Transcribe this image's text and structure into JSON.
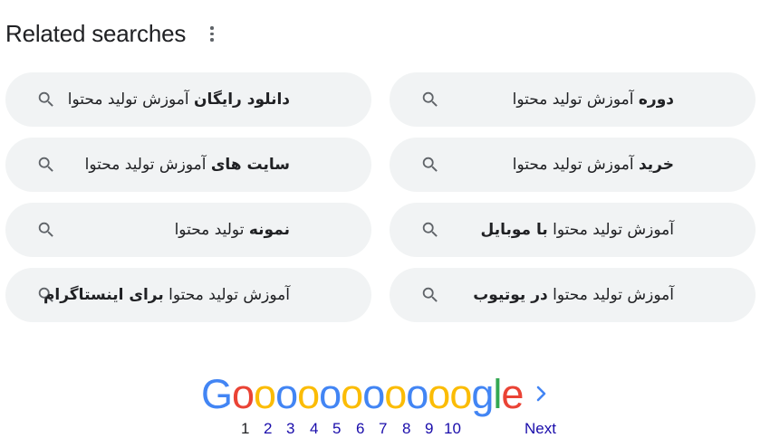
{
  "header": {
    "title": "Related searches"
  },
  "searches": [
    {
      "bold": "دانلود رایگان",
      "rest": "آموزش تولید محتوا",
      "order": "bold-first"
    },
    {
      "bold": "دوره",
      "rest": "آموزش تولید محتوا",
      "order": "bold-first"
    },
    {
      "bold": "سایت های",
      "rest": "آموزش تولید محتوا",
      "order": "bold-first"
    },
    {
      "bold": "خرید",
      "rest": "آموزش تولید محتوا",
      "order": "bold-first"
    },
    {
      "bold": "نمونه",
      "rest": "تولید محتوا",
      "order": "bold-first"
    },
    {
      "bold": "با موبایل",
      "rest": "آموزش تولید محتوا",
      "order": "rest-first"
    },
    {
      "bold": "برای اینستاگرام",
      "rest": "آموزش تولید محتوا",
      "order": "rest-first"
    },
    {
      "bold": "در یوتیوب",
      "rest": "آموزش تولید محتوا",
      "order": "rest-first"
    }
  ],
  "pagination": {
    "logo": [
      "G",
      "o",
      "o",
      "o",
      "o",
      "o",
      "o",
      "o",
      "o",
      "o",
      "o",
      "o",
      "g",
      "l",
      "e"
    ],
    "pages": [
      "1",
      "2",
      "3",
      "4",
      "5",
      "6",
      "7",
      "8",
      "9",
      "10"
    ],
    "current": "1",
    "next_label": "Next"
  },
  "colors": {
    "chip_bg": "#f1f3f4",
    "link": "#1a0dab",
    "logo_blue": "#4285f4",
    "logo_red": "#ea4335",
    "logo_yellow": "#fbbc05",
    "logo_green": "#34a853"
  },
  "icons": {
    "chip": "search-icon",
    "more": "more-vert-icon",
    "next": "chevron-right-icon"
  }
}
